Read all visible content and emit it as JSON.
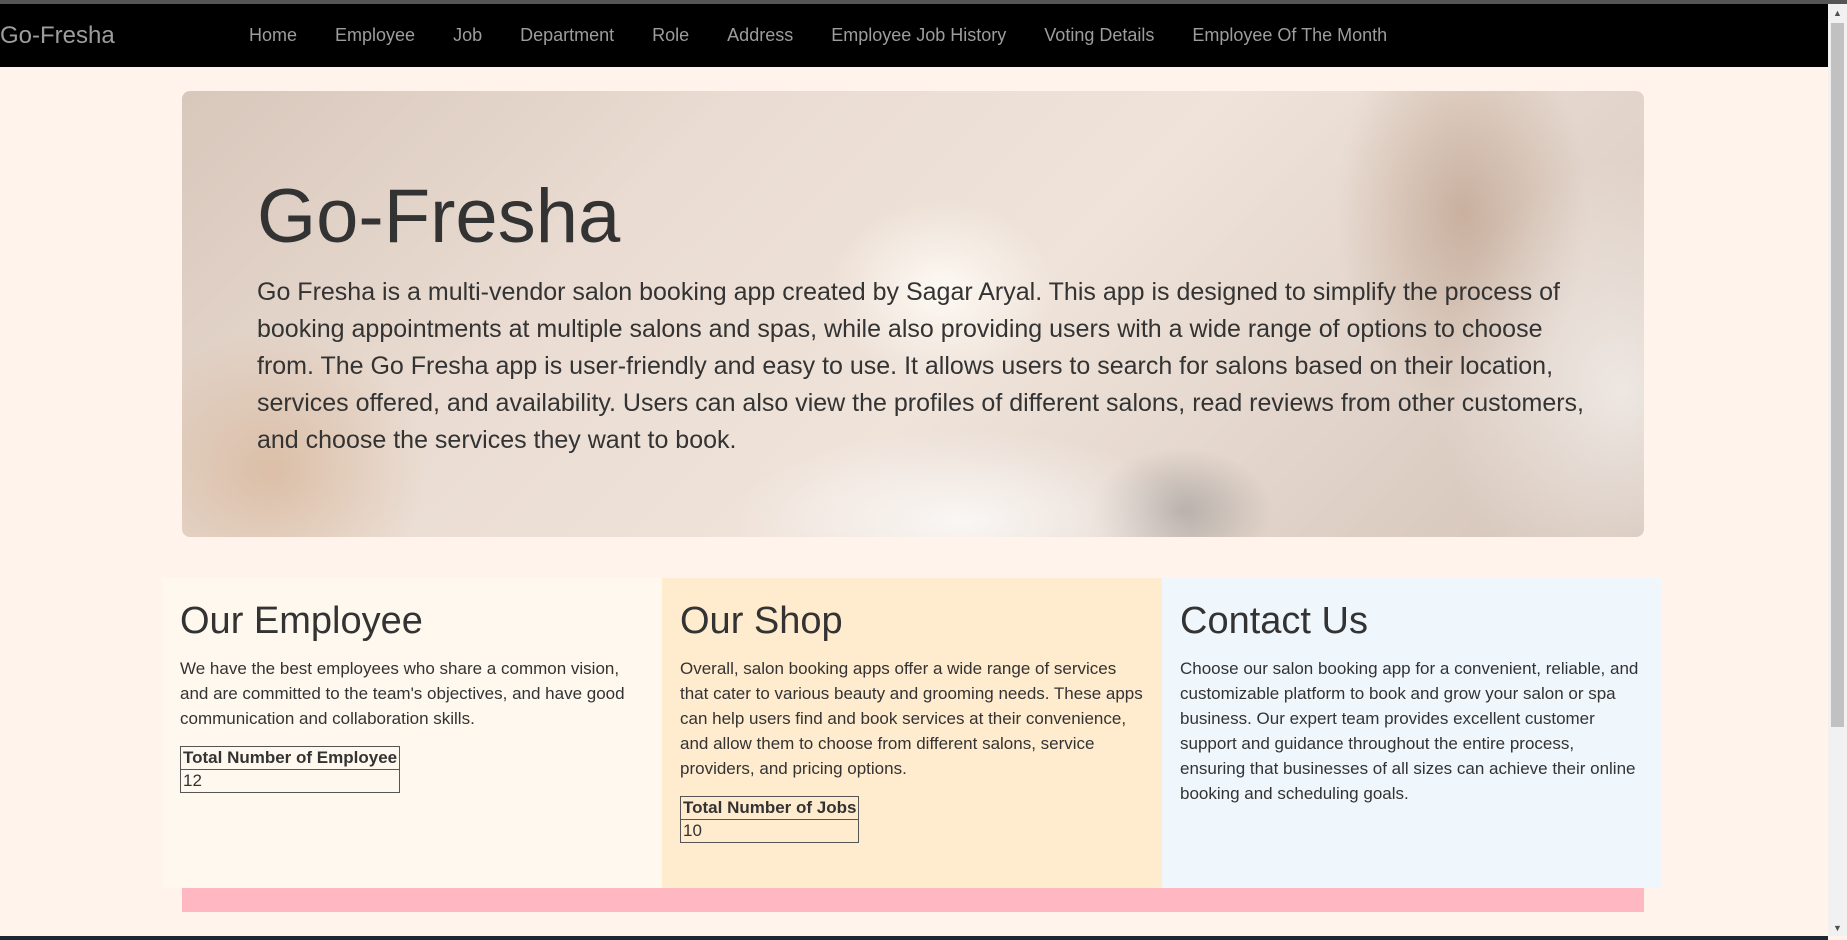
{
  "navbar": {
    "brand": "Go-Fresha",
    "items": [
      {
        "label": "Home"
      },
      {
        "label": "Employee"
      },
      {
        "label": "Job"
      },
      {
        "label": "Department"
      },
      {
        "label": "Role"
      },
      {
        "label": "Address"
      },
      {
        "label": "Employee Job History"
      },
      {
        "label": "Voting Details"
      },
      {
        "label": "Employee Of The Month"
      }
    ]
  },
  "hero": {
    "title": "Go-Fresha",
    "text": "Go Fresha is a multi-vendor salon booking app created by Sagar Aryal. This app is designed to simplify the process of booking appointments at multiple salons and spas, while also providing users with a wide range of options to choose from. The Go Fresha app is user-friendly and easy to use. It allows users to search for salons based on their location, services offered, and availability. Users can also view the profiles of different salons, read reviews from other customers, and choose the services they want to book."
  },
  "cards": [
    {
      "title": "Our Employee",
      "text": "We have the best employees who share a common vision, and are committed to the team's objectives, and have good communication and collaboration skills.",
      "stat_header": "Total Number of Employee",
      "stat_value": "12",
      "bg": "#fff8ee"
    },
    {
      "title": "Our Shop",
      "text": "Overall, salon booking apps offer a wide range of services that cater to various beauty and grooming needs. These apps can help users find and book services at their convenience, and allow them to choose from different salons, service providers, and pricing options.",
      "stat_header": "Total Number of Jobs",
      "stat_value": "10",
      "bg": "#ffebcd"
    },
    {
      "title": "Contact Us",
      "text": "Choose our salon booking app for a convenient, reliable, and customizable platform to book and grow your salon or spa business. Our expert team provides excellent customer support and guidance throughout the entire process, ensuring that businesses of all sizes can achieve their online booking and scheduling goals.",
      "bg": "#eff6fc"
    }
  ],
  "footer_bar": {
    "color": "#ffb7c1"
  },
  "colors": {
    "navbar_bg": "#000000",
    "nav_text": "#9d9d9d",
    "page_bg": "#fff3ec"
  }
}
